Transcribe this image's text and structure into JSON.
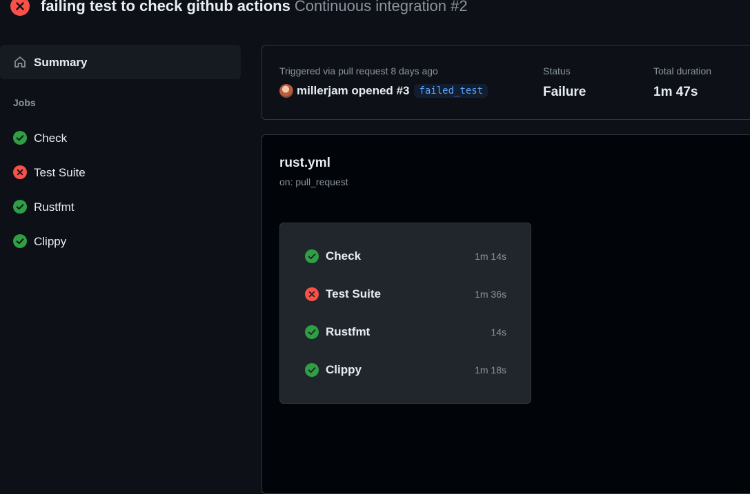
{
  "header": {
    "title": "failing test to check github actions",
    "subtitle": "Continuous integration #2",
    "status_icon": "x-circle-fill-icon"
  },
  "sidebar": {
    "summary_label": "Summary",
    "summary_icon": "home-icon",
    "jobs_heading": "Jobs",
    "jobs": [
      {
        "label": "Check",
        "status": "success"
      },
      {
        "label": "Test Suite",
        "status": "failure"
      },
      {
        "label": "Rustfmt",
        "status": "success"
      },
      {
        "label": "Clippy",
        "status": "success"
      }
    ]
  },
  "run_info": {
    "trigger_label": "Triggered via pull request 8 days ago",
    "actor_text": "millerjam opened #3",
    "branch": "failed_test",
    "status_label": "Status",
    "status_value": "Failure",
    "duration_label": "Total duration",
    "duration_value": "1m 47s"
  },
  "workflow": {
    "file_name": "rust.yml",
    "event": "on: pull_request",
    "jobs": [
      {
        "label": "Check",
        "time": "1m 14s",
        "status": "success"
      },
      {
        "label": "Test Suite",
        "time": "1m 36s",
        "status": "failure"
      },
      {
        "label": "Rustfmt",
        "time": "14s",
        "status": "success"
      },
      {
        "label": "Clippy",
        "time": "1m 18s",
        "status": "success"
      }
    ]
  },
  "colors": {
    "success": "#2ea043",
    "failure": "#f85149",
    "background": "#0d1117",
    "branch_text": "#58a6ff"
  }
}
